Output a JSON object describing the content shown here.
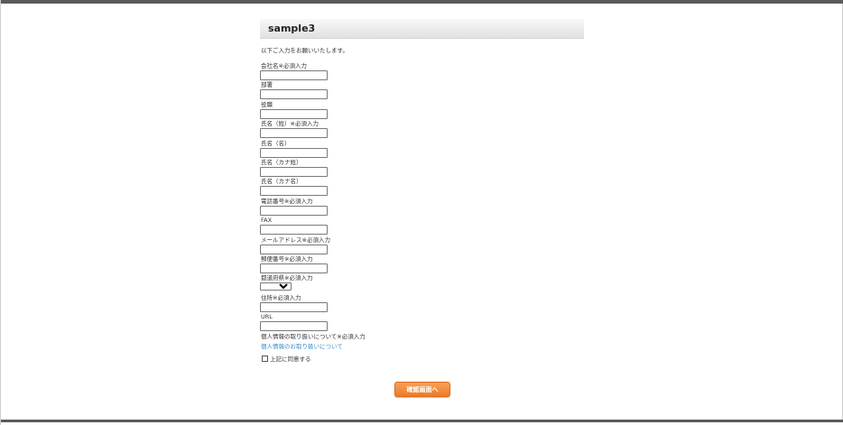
{
  "page": {
    "title": "sample3",
    "intro": "以下ご入力をお願いいたします。"
  },
  "form": {
    "fields": [
      {
        "label": "会社名※必須入力",
        "type": "text",
        "value": ""
      },
      {
        "label": "部署",
        "type": "text",
        "value": ""
      },
      {
        "label": "役職",
        "type": "text",
        "value": ""
      },
      {
        "label": "氏名（姓）※必須入力",
        "type": "text",
        "value": ""
      },
      {
        "label": "氏名（名）",
        "type": "text",
        "value": ""
      },
      {
        "label": "氏名（カナ姓）",
        "type": "text",
        "value": ""
      },
      {
        "label": "氏名（カナ名）",
        "type": "text",
        "value": ""
      },
      {
        "label": "電話番号※必須入力",
        "type": "text",
        "value": ""
      },
      {
        "label": "FAX",
        "type": "text",
        "value": ""
      },
      {
        "label": "メールアドレス※必須入力",
        "type": "text",
        "value": ""
      },
      {
        "label": "郵便番号※必須入力",
        "type": "text",
        "value": ""
      },
      {
        "label": "都道府県※必須入力",
        "type": "select",
        "value": ""
      },
      {
        "label": "住所※必須入力",
        "type": "text",
        "value": ""
      },
      {
        "label": "URL",
        "type": "text",
        "value": ""
      }
    ],
    "privacy_label": "個人情報の取り扱いについて※必須入力",
    "privacy_link": "個人情報のお取り扱いについて",
    "agree_label": "上記に同意する",
    "agree_checked": false,
    "submit_label": "確認画面へ"
  },
  "colors": {
    "accent": "#ee7a25",
    "link": "#3a8bc7",
    "frame": "#5b5b5b"
  }
}
